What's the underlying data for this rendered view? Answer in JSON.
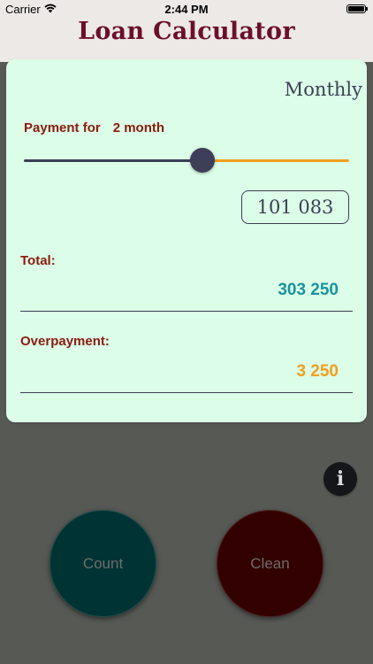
{
  "status_bar": {
    "carrier": "Carrier",
    "time": "2:44 PM"
  },
  "app": {
    "title": "Loan Calculator"
  },
  "card": {
    "mode": "Monthly",
    "payment_for_label": "Payment for",
    "payment_for_value": "2 month",
    "slider_fraction": 0.55,
    "monthly_payment": "101 083",
    "total_label": "Total:",
    "total_value": "303 250",
    "overpayment_label": "Overpayment:",
    "overpayment_value": "3 250"
  },
  "actions": {
    "info_glyph": "i",
    "count_label": "Count",
    "clean_label": "Clean"
  },
  "colors": {
    "title": "#6b0f2b",
    "label": "#8b1a10",
    "total_value": "#1a93a0",
    "overpayment_value": "#f0a020",
    "card_bg": "#dcfde7",
    "slider_left": "#3c3f57",
    "slider_right": "#f0a020"
  },
  "icons": {
    "signal": "wifi-icon",
    "battery": "battery-icon",
    "info": "info-icon"
  }
}
